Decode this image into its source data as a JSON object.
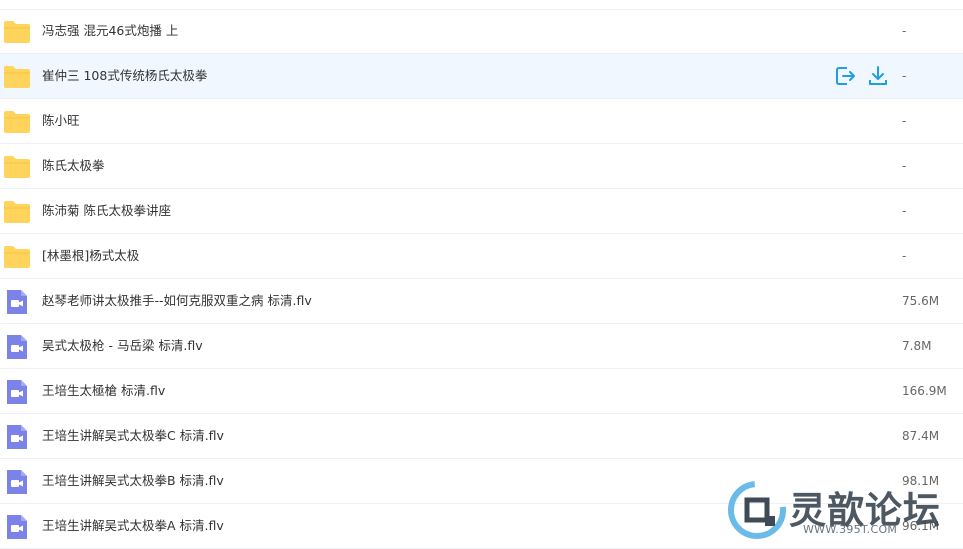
{
  "files": [
    {
      "name": "冯志强 混元46式炮播 上",
      "size": "-",
      "type": "folder"
    },
    {
      "name": "崔仲三 108式传统杨氏太极拳",
      "size": "-",
      "type": "folder",
      "hover": true
    },
    {
      "name": "陈小旺",
      "size": "-",
      "type": "folder"
    },
    {
      "name": "陈氏太极拳",
      "size": "-",
      "type": "folder"
    },
    {
      "name": "陈沛菊 陈氏太极拳讲座",
      "size": "-",
      "type": "folder"
    },
    {
      "name": "[林墨根]杨式太极",
      "size": "-",
      "type": "folder"
    },
    {
      "name": "赵琴老师讲太极推手--如何克服双重之病 标清.flv",
      "size": "75.6M",
      "type": "video"
    },
    {
      "name": "吴式太极枪 - 马岳梁 标清.flv",
      "size": "7.8M",
      "type": "video"
    },
    {
      "name": "王培生太極槍 标清.flv",
      "size": "166.9M",
      "type": "video"
    },
    {
      "name": "王培生讲解吴式太极拳C 标清.flv",
      "size": "87.4M",
      "type": "video"
    },
    {
      "name": "王培生讲解吴式太极拳B 标清.flv",
      "size": "98.1M",
      "type": "video"
    },
    {
      "name": "王培生讲解吴式太极拳A 标清.flv",
      "size": "96.1M",
      "type": "video"
    }
  ],
  "row_actions": {
    "icons": [
      "share-icon",
      "download-icon"
    ]
  },
  "watermark": {
    "title": "灵歆论坛",
    "url": "WWW.395T.COM"
  },
  "colors": {
    "folder": "#ffd45c",
    "video": "#7b83e8",
    "action": "#1e9fe0",
    "hover_row": "#f0f7fe"
  }
}
